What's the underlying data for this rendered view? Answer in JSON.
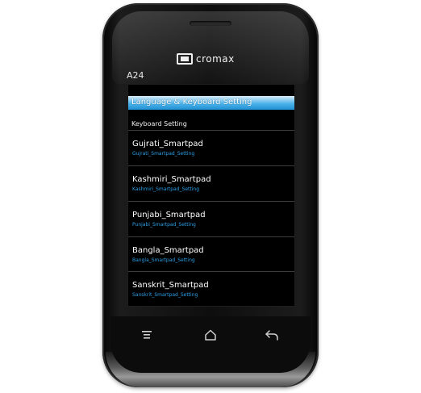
{
  "device": {
    "brand": "cromax",
    "model": "A24"
  },
  "screen": {
    "title": "Language & Keyboard Setting",
    "section_header": "Keyboard Setting",
    "items": [
      {
        "title": "Gujrati_Smartpad",
        "subtitle": "Gujrati_Smartpad_Setting"
      },
      {
        "title": "Kashmiri_Smartpad",
        "subtitle": "Kashmiri_Smartpad_Setting"
      },
      {
        "title": "Punjabi_Smartpad",
        "subtitle": "Punjabi_Smartpad_Setting"
      },
      {
        "title": "Bangla_Smartpad",
        "subtitle": "Bangla_Smartpad_Setting"
      },
      {
        "title": "Sanskrit_Smartpad",
        "subtitle": "Sanskrit_Smartpad_Setting"
      }
    ]
  },
  "hardware_keys": [
    {
      "icon": "menu-icon"
    },
    {
      "icon": "home-icon"
    },
    {
      "icon": "back-icon"
    }
  ],
  "colors": {
    "title_bar": "#2aa0e8",
    "subtitle_text": "#2aa0e8",
    "screen_background": "#000000"
  }
}
